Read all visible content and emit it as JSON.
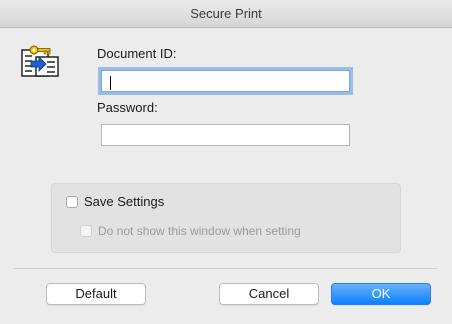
{
  "window": {
    "title": "Secure Print"
  },
  "form": {
    "document_id_label": "Document ID:",
    "document_id_value": "",
    "password_label": "Password:",
    "password_value": ""
  },
  "settings": {
    "save_settings_label": "Save Settings",
    "save_settings_checked": false,
    "dont_show_label": "Do not show this window when setting",
    "dont_show_checked": false,
    "dont_show_enabled": false
  },
  "buttons": {
    "default_label": "Default",
    "cancel_label": "Cancel",
    "ok_label": "OK"
  },
  "colors": {
    "accent": "#0d81ff",
    "focus_ring": "#5896e6"
  }
}
